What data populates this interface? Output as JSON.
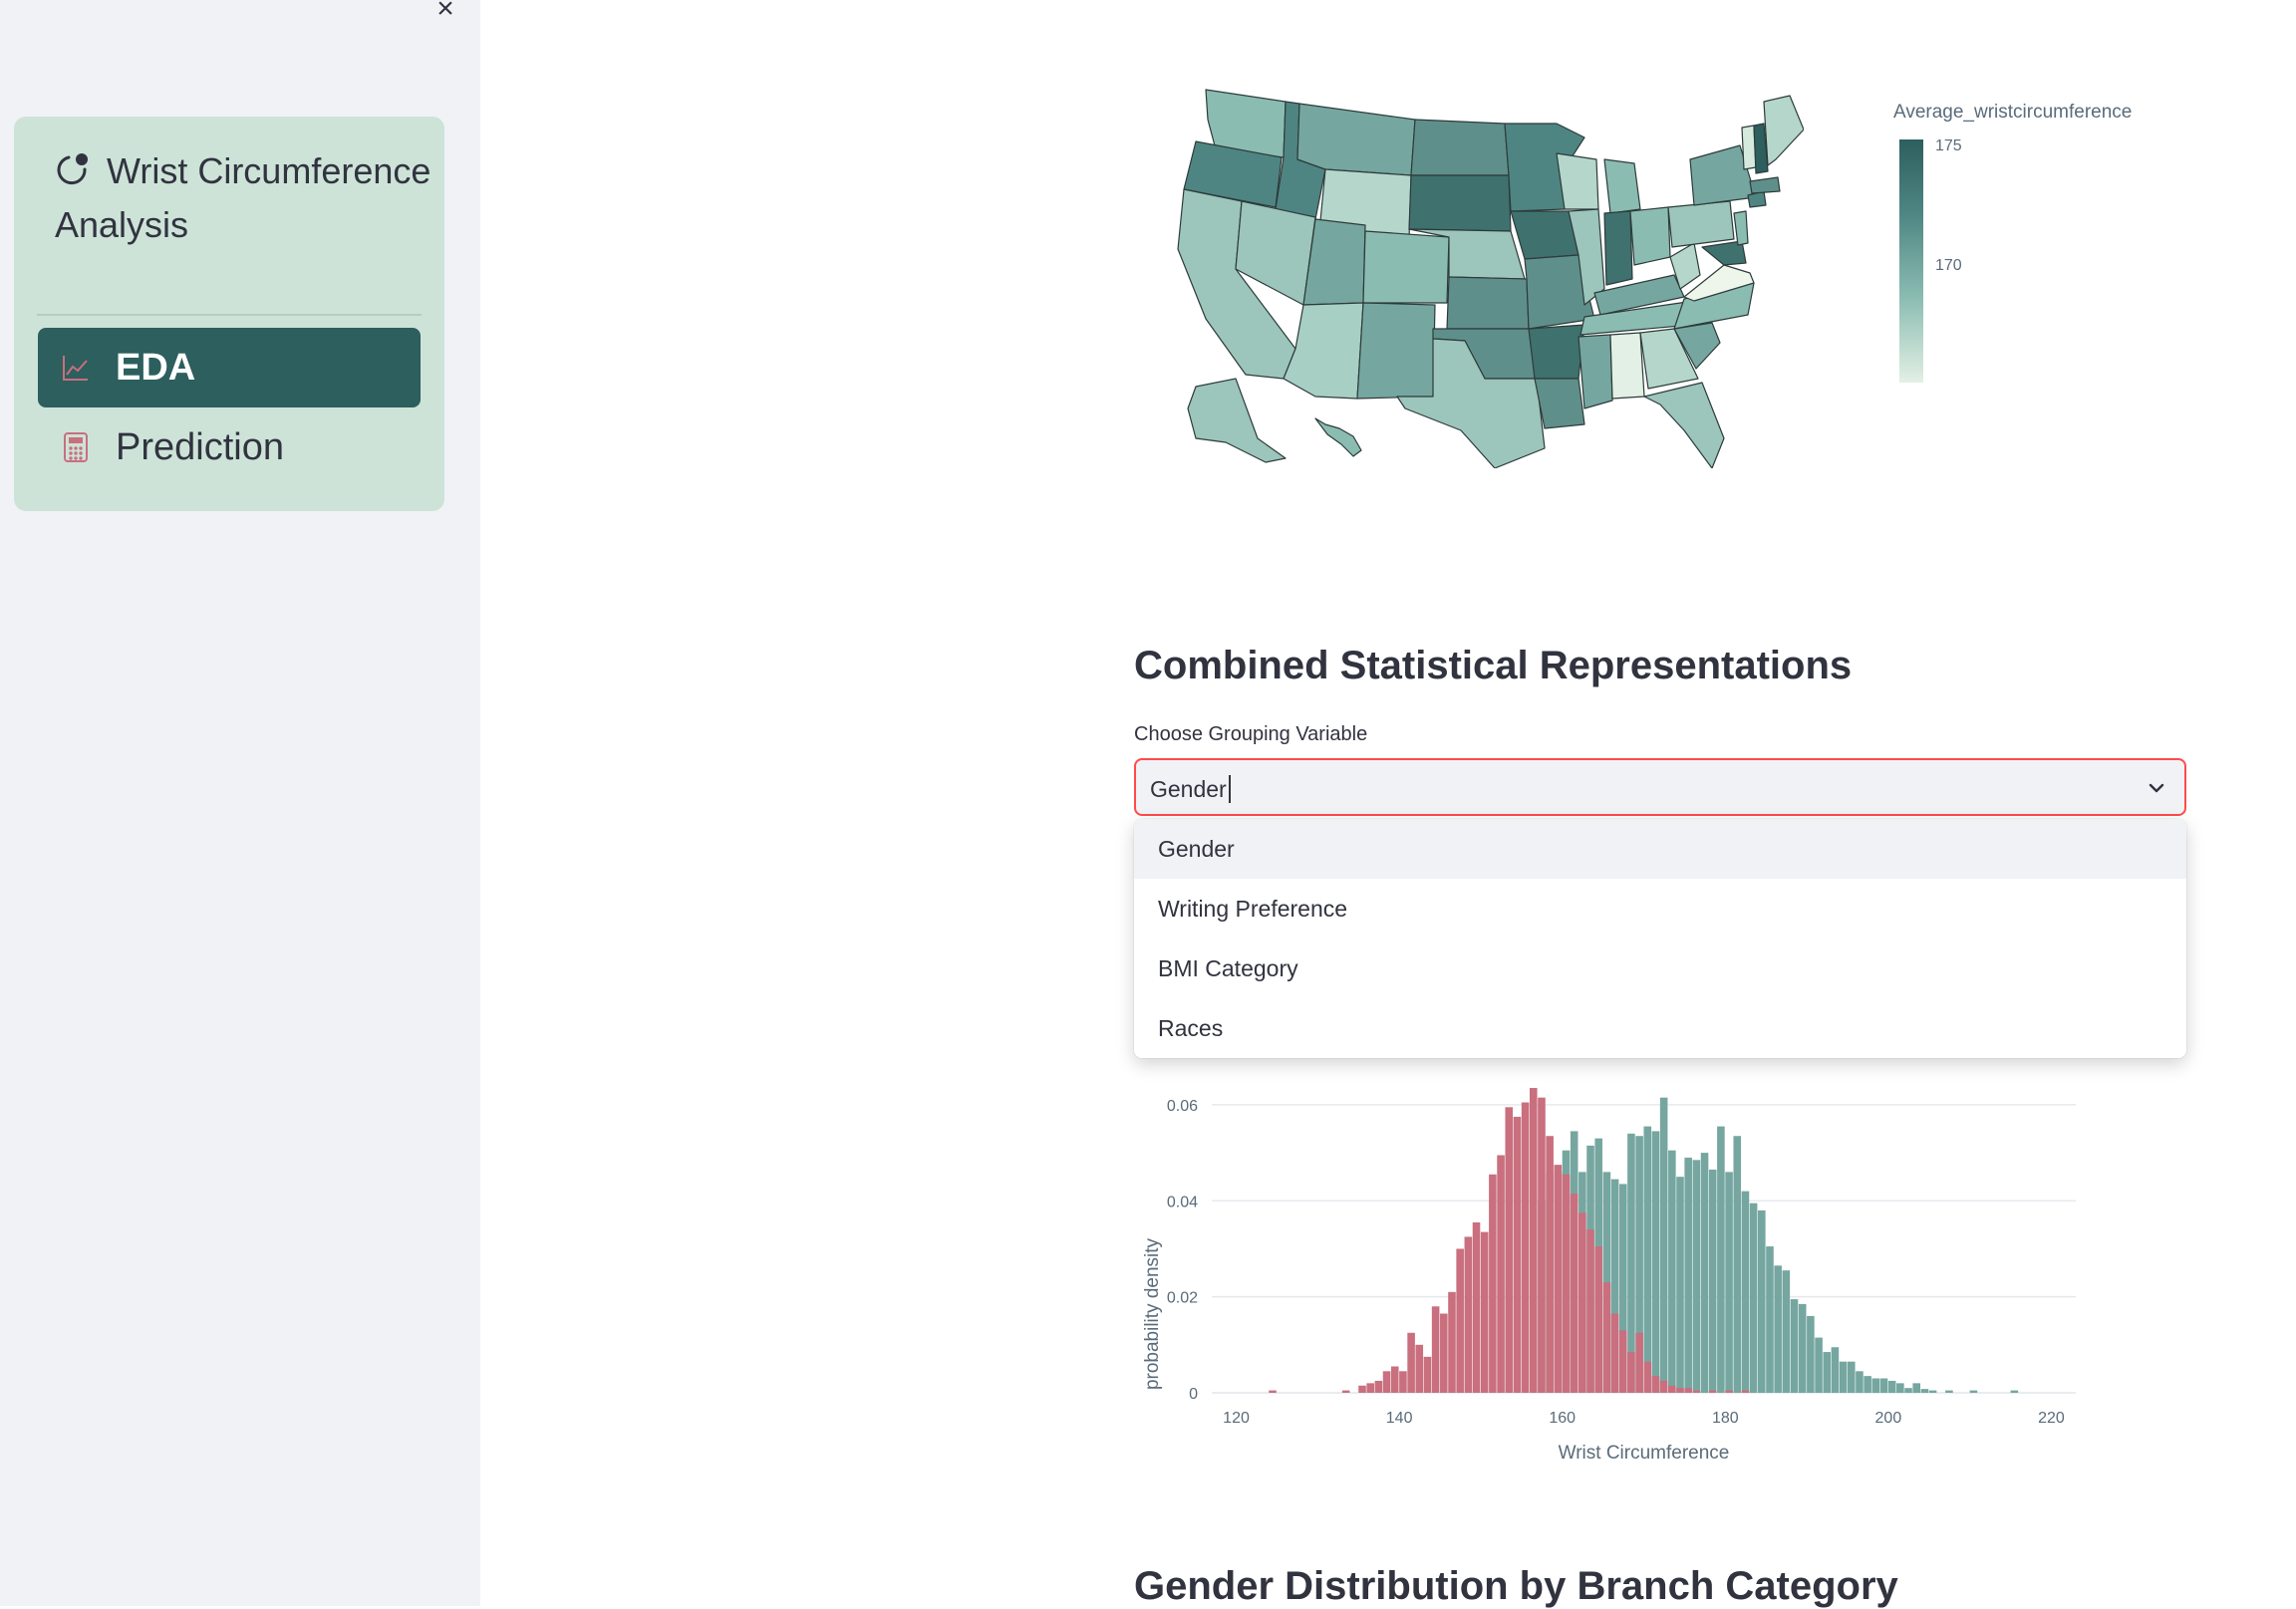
{
  "sidebar": {
    "close_icon": "×",
    "app_title": "Wrist Circumference Analysis",
    "items": [
      {
        "label": "EDA",
        "icon": "chart-line-icon",
        "active": true
      },
      {
        "label": "Prediction",
        "icon": "calculator-icon",
        "active": false
      }
    ]
  },
  "map": {
    "legend_title": "Average_wristcircumference",
    "legend_ticks": [
      "175",
      "170"
    ]
  },
  "section_combined": {
    "title": "Combined Statistical Representations",
    "select_label": "Choose Grouping Variable",
    "select_value": "Gender",
    "options": [
      "Gender",
      "Writing Preference",
      "BMI Category",
      "Races"
    ],
    "highlighted_option": "Gender"
  },
  "next_section": {
    "title": "Gender Distribution by Branch Category"
  },
  "colors": {
    "accent": "#2c5f5d",
    "male": "#76a6a0",
    "female": "#c96f7e",
    "focus": "#ff4b4b"
  },
  "chart_data": {
    "type": "bar",
    "xlabel": "Wrist Circumference",
    "ylabel": "probability density",
    "xlim": [
      117,
      223
    ],
    "ylim": [
      0,
      0.066
    ],
    "x_ticks": [
      "120",
      "140",
      "160",
      "180",
      "200",
      "220"
    ],
    "y_ticks": [
      "0",
      "0.02",
      "0.04",
      "0.06"
    ],
    "bin_width": 1,
    "series": [
      {
        "color": "#c96f7e",
        "bins": [
          [
            124,
            0.0005
          ],
          [
            133,
            0.0005
          ],
          [
            135,
            0.0015
          ],
          [
            136,
            0.002
          ],
          [
            137,
            0.0025
          ],
          [
            138,
            0.0045
          ],
          [
            139,
            0.0055
          ],
          [
            140,
            0.0045
          ],
          [
            141,
            0.0125
          ],
          [
            142,
            0.01
          ],
          [
            143,
            0.0075
          ],
          [
            144,
            0.018
          ],
          [
            145,
            0.0165
          ],
          [
            146,
            0.021
          ],
          [
            147,
            0.03
          ],
          [
            148,
            0.0325
          ],
          [
            149,
            0.0355
          ],
          [
            150,
            0.0335
          ],
          [
            151,
            0.0455
          ],
          [
            152,
            0.0495
          ],
          [
            153,
            0.0595
          ],
          [
            154,
            0.0575
          ],
          [
            155,
            0.0605
          ],
          [
            156,
            0.0635
          ],
          [
            157,
            0.0615
          ],
          [
            158,
            0.0535
          ],
          [
            159,
            0.0475
          ],
          [
            160,
            0.0455
          ],
          [
            161,
            0.0415
          ],
          [
            162,
            0.0375
          ],
          [
            163,
            0.034
          ],
          [
            164,
            0.0305
          ],
          [
            165,
            0.023
          ],
          [
            166,
            0.0165
          ],
          [
            167,
            0.013
          ],
          [
            168,
            0.0085
          ],
          [
            169,
            0.0125
          ],
          [
            170,
            0.0065
          ],
          [
            171,
            0.0035
          ],
          [
            172,
            0.0025
          ],
          [
            173,
            0.0015
          ],
          [
            174,
            0.001
          ],
          [
            175,
            0.001
          ],
          [
            176,
            0.0005
          ],
          [
            178,
            0.0005
          ],
          [
            180,
            0.0005
          ],
          [
            182,
            0.0005
          ]
        ]
      },
      {
        "color": "#76a6a0",
        "bins": [
          [
            157,
            0.04
          ],
          [
            158,
            0.0455
          ],
          [
            159,
            0.046
          ],
          [
            160,
            0.0505
          ],
          [
            161,
            0.0545
          ],
          [
            162,
            0.046
          ],
          [
            163,
            0.0515
          ],
          [
            164,
            0.053
          ],
          [
            165,
            0.046
          ],
          [
            166,
            0.0445
          ],
          [
            167,
            0.0435
          ],
          [
            168,
            0.054
          ],
          [
            169,
            0.0535
          ],
          [
            170,
            0.0555
          ],
          [
            171,
            0.0545
          ],
          [
            172,
            0.0615
          ],
          [
            173,
            0.0505
          ],
          [
            174,
            0.045
          ],
          [
            175,
            0.049
          ],
          [
            176,
            0.0485
          ],
          [
            177,
            0.05
          ],
          [
            178,
            0.0465
          ],
          [
            179,
            0.0555
          ],
          [
            180,
            0.046
          ],
          [
            181,
            0.0535
          ],
          [
            182,
            0.042
          ],
          [
            183,
            0.0395
          ],
          [
            184,
            0.038
          ],
          [
            185,
            0.0305
          ],
          [
            186,
            0.0265
          ],
          [
            187,
            0.0255
          ],
          [
            188,
            0.0195
          ],
          [
            189,
            0.0185
          ],
          [
            190,
            0.016
          ],
          [
            191,
            0.0115
          ],
          [
            192,
            0.0085
          ],
          [
            193,
            0.0095
          ],
          [
            194,
            0.0065
          ],
          [
            195,
            0.0065
          ],
          [
            196,
            0.0045
          ],
          [
            197,
            0.0035
          ],
          [
            198,
            0.003
          ],
          [
            199,
            0.003
          ],
          [
            200,
            0.0025
          ],
          [
            201,
            0.002
          ],
          [
            202,
            0.001
          ],
          [
            203,
            0.002
          ],
          [
            204,
            0.0008
          ],
          [
            205,
            0.0005
          ],
          [
            207,
            0.0005
          ],
          [
            210,
            0.0005
          ],
          [
            215,
            0.0005
          ]
        ]
      }
    ]
  }
}
